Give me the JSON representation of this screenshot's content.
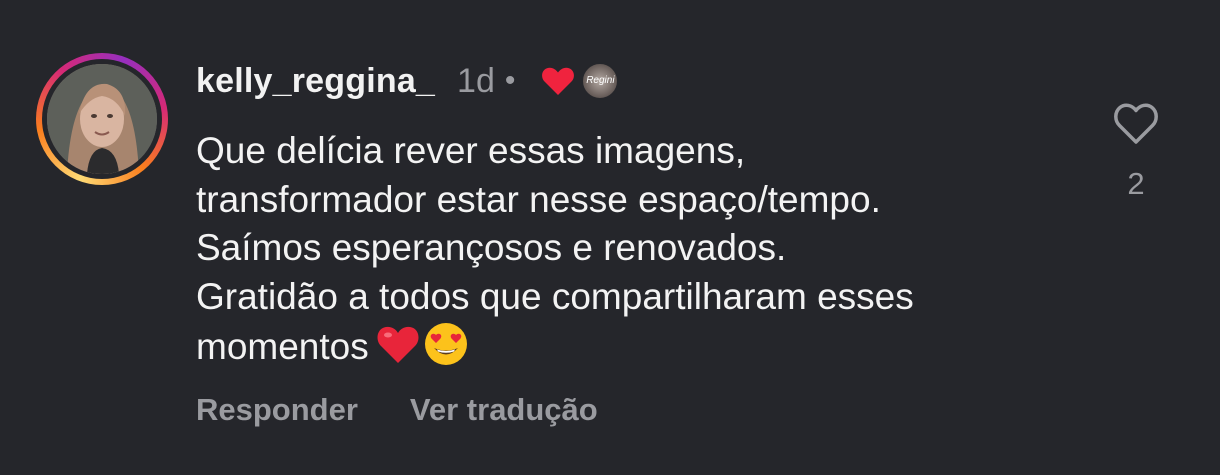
{
  "comment": {
    "username": "kelly_reggina_",
    "time_ago": "1d",
    "separator": "•",
    "creator_badge_text": "Regini",
    "lines": [
      "Que delícia rever essas imagens,",
      "transformador estar nesse espaço/tempo.",
      "Saímos esperançosos e renovados.",
      "Gratidão a todos que compartilharam esses",
      "momentos"
    ],
    "trailing_emojis": [
      "red-heart",
      "smiling-face-with-heart-eyes"
    ],
    "like_count": "2"
  },
  "actions": {
    "reply_label": "Responder",
    "translate_label": "Ver tradução"
  },
  "colors": {
    "background": "#25262b",
    "text_primary": "#f3f3f3",
    "text_secondary": "#9a9ba0",
    "heart_red": "#f0233e"
  }
}
